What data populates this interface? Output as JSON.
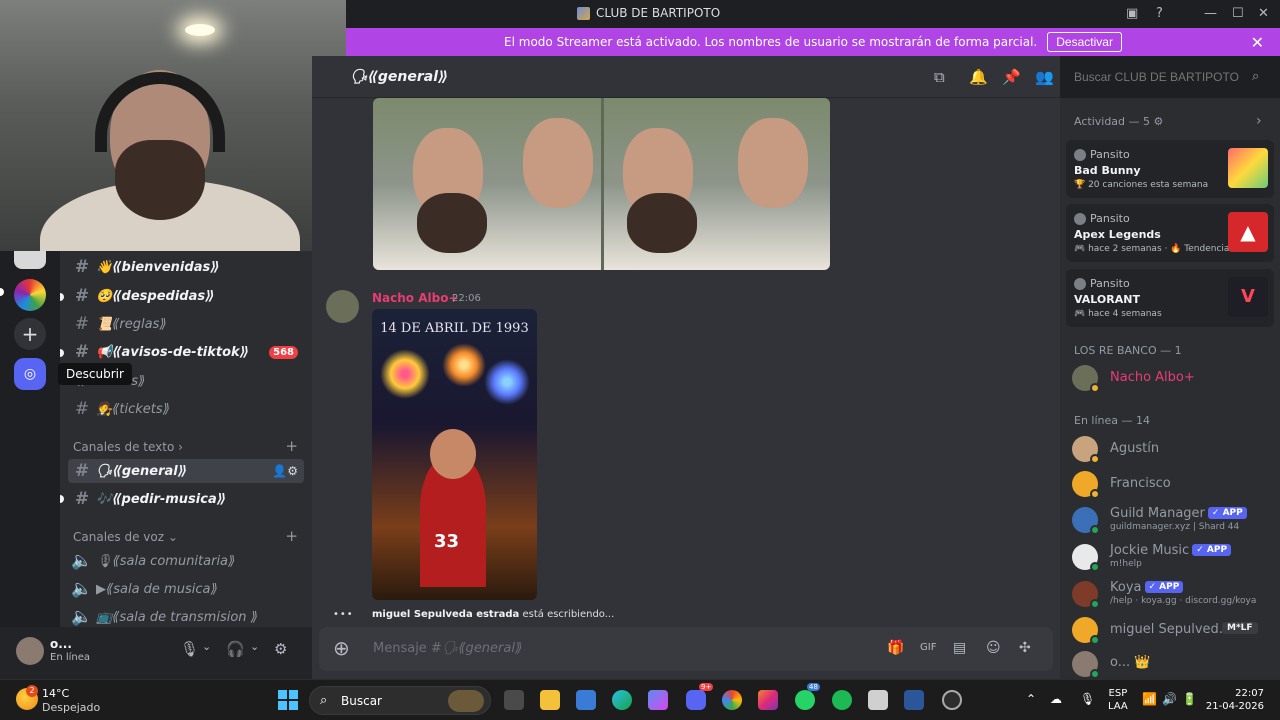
{
  "window": {
    "title": "CLUB DE BARTIPOTO"
  },
  "banner": {
    "text": "El modo Streamer está activado. Los nombres de usuario se mostrarán de forma parcial.",
    "button": "Desactivar",
    "close": "✕"
  },
  "rail": {
    "tooltip": "Descubrir",
    "add": "+"
  },
  "channels": {
    "items": [
      {
        "label": "👋⟪bienvenidas⟫",
        "bold": false
      },
      {
        "label": "🥺⟪despedidas⟫",
        "bold": true
      },
      {
        "label": "📜⟪reglas⟫",
        "bold": false
      },
      {
        "label": "📢⟪avisos-de-tiktok⟫",
        "bold": true,
        "badge": "568"
      },
      {
        "label": "uncios⟫",
        "bold": false
      },
      {
        "label": "🧑‍⚖️⟪tickets⟫",
        "bold": false
      }
    ],
    "text_category": "Canales de texto",
    "text_items": [
      {
        "label": "🗣⟪general⟫"
      },
      {
        "label": "🎶⟪pedir-musica⟫"
      }
    ],
    "voice_category": "Canales de voz",
    "voice_items": [
      {
        "label": "🎙⟪sala comunitaria⟫"
      },
      {
        "label": "▶⟪sala de musica⟫"
      },
      {
        "label": "📺⟪sala de transmision ⟫"
      }
    ]
  },
  "user": {
    "name": "o...",
    "status": "En línea"
  },
  "chat": {
    "channel": "🗣⟪general⟫",
    "search_placeholder": "Buscar CLUB DE BARTIPOTO",
    "message": {
      "author": "Nacho Albo+",
      "time": "22:06",
      "poster_title": "14 DE ABRIL DE 1993",
      "poster_number": "33"
    },
    "typing_user": "miguel Sepulveda estrada",
    "typing_text": "está escribiendo...",
    "composer_prefix": "Mensaje #",
    "composer_channel": "🗣⟪general⟫"
  },
  "sidebar": {
    "activity_title": "Actividad — 5",
    "activities": [
      {
        "user": "Pansito",
        "game": "Bad Bunny",
        "meta": "🏆 20 canciones esta semana",
        "color": "#e8584a"
      },
      {
        "user": "Pansito",
        "game": "Apex Legends",
        "meta": "🎮 hace 2 semanas · 🔥 Tendencia",
        "color": "#d6272a"
      },
      {
        "user": "Pansito",
        "game": "VALORANT",
        "meta": "🎮 hace 4 semanas",
        "color": "#1e1e26"
      }
    ],
    "role_title": "LOS RE BANCO — 1",
    "role_member": "Nacho Albo+",
    "online_title": "En línea — 14",
    "members": [
      {
        "name": "Agustín",
        "sub": "",
        "app": false,
        "color": "#c9a27e"
      },
      {
        "name": "Francisco",
        "sub": "",
        "app": false,
        "color": "#f0a828"
      },
      {
        "name": "Guild Manager",
        "sub": "guildmanager.xyz | Shard 44",
        "app": true,
        "color": "#3b6fb8"
      },
      {
        "name": "Jockie Music",
        "sub": "m!help",
        "app": true,
        "color": "#e9e9e9"
      },
      {
        "name": "Koya",
        "sub": "/help · koya.gg · discord.gg/koya",
        "app": true,
        "color": "#7e3b2a"
      },
      {
        "name": "miguel Sepulved...",
        "sub": "",
        "app": false,
        "color": "#f0a828"
      },
      {
        "name": "o... 👑",
        "sub": "",
        "app": false,
        "color": "#8a7a70"
      }
    ],
    "app_label": "✓ APP",
    "mlf_tag": "M*LF"
  },
  "taskbar": {
    "temp": "14°C",
    "sky": "Despejado",
    "weather_badge": "2",
    "search": "Buscar",
    "lang1": "ESP",
    "lang2": "LAA",
    "time": "22:07",
    "date": "21-04-2026",
    "discord_badge": "9+",
    "whatsapp_badge": "48"
  }
}
